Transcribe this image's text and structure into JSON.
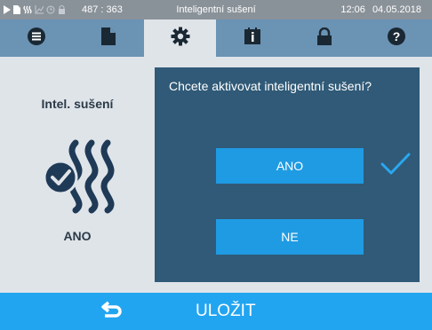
{
  "status_bar": {
    "coordinates": "487 : 363",
    "title": "Inteligentní sušení",
    "time": "12:06",
    "date": "04.05.2018",
    "icons": [
      "play-icon",
      "document-icon",
      "drying-icon",
      "chart-icon",
      "clock-icon",
      "lock-icon"
    ]
  },
  "tabs": [
    {
      "icon": "list-icon",
      "active": false
    },
    {
      "icon": "document-icon",
      "active": false
    },
    {
      "icon": "gear-icon",
      "active": true
    },
    {
      "icon": "info-book-icon",
      "active": false
    },
    {
      "icon": "lock-icon",
      "active": false
    },
    {
      "icon": "help-icon",
      "active": false
    }
  ],
  "feature": {
    "title": "Intel. sušení",
    "state": "ANO",
    "icon": "intelligent-drying-icon"
  },
  "dialog": {
    "question": "Chcete aktivovat inteligentní sušení?",
    "yes_label": "ANO",
    "no_label": "NE",
    "selected": "ANO"
  },
  "bottom_bar": {
    "save_label": "ULOŽIT",
    "back_icon": "back-arrow-icon"
  },
  "colors": {
    "status_bar": "#8a9299",
    "tab_bar": "#6b93b4",
    "background": "#dfe4e9",
    "dialog": "#305a77",
    "button": "#1f9be3",
    "bottom_bar": "#22a5f0",
    "text_dark": "#2b3a48",
    "check": "#2aa7f0"
  }
}
